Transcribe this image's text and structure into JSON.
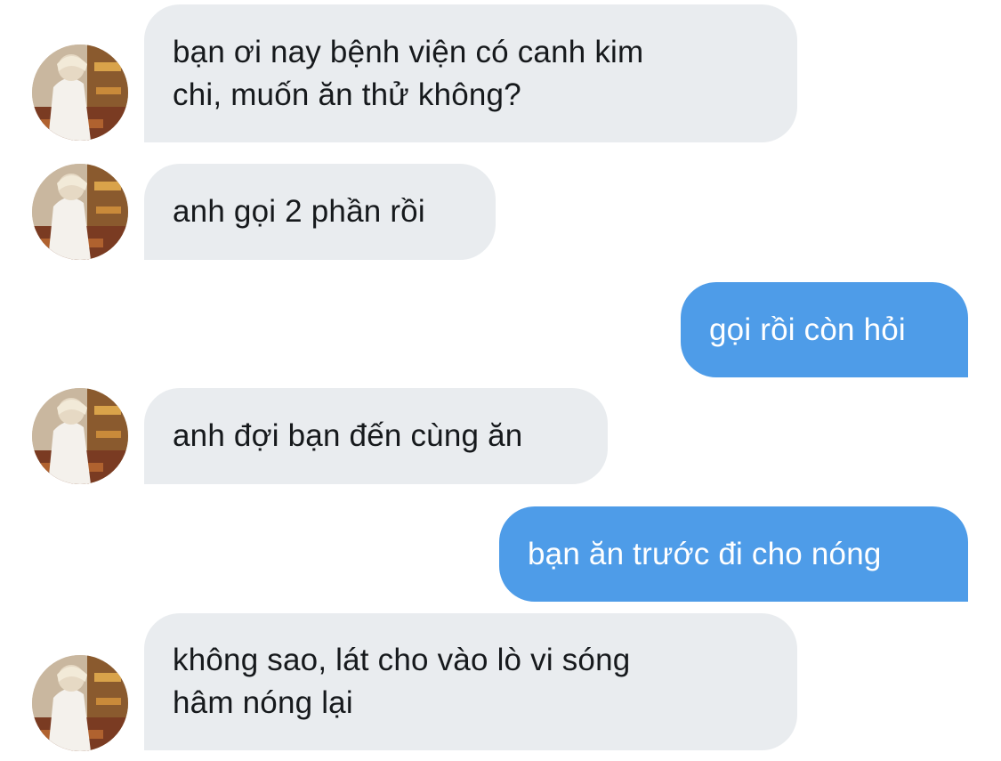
{
  "colors": {
    "incoming_bubble": "#e9ecef",
    "outgoing_bubble": "#4e9ce8",
    "incoming_text": "#16191c",
    "outgoing_text": "#ffffff"
  },
  "avatar_icon": "user-photo-avatar",
  "messages": [
    {
      "sender": "other",
      "lines": [
        "bạn ơi nay bệnh viện có canh kim",
        "chi, muốn ăn thử không?"
      ]
    },
    {
      "sender": "other",
      "lines": [
        "anh gọi 2 phần rồi"
      ]
    },
    {
      "sender": "me",
      "lines": [
        "gọi rồi còn hỏi"
      ]
    },
    {
      "sender": "other",
      "lines": [
        "anh đợi bạn đến cùng ăn"
      ]
    },
    {
      "sender": "me",
      "lines": [
        "bạn ăn trước đi cho nóng"
      ]
    },
    {
      "sender": "other",
      "lines": [
        "không sao, lát cho vào lò vi sóng",
        "hâm nóng lại"
      ]
    }
  ]
}
